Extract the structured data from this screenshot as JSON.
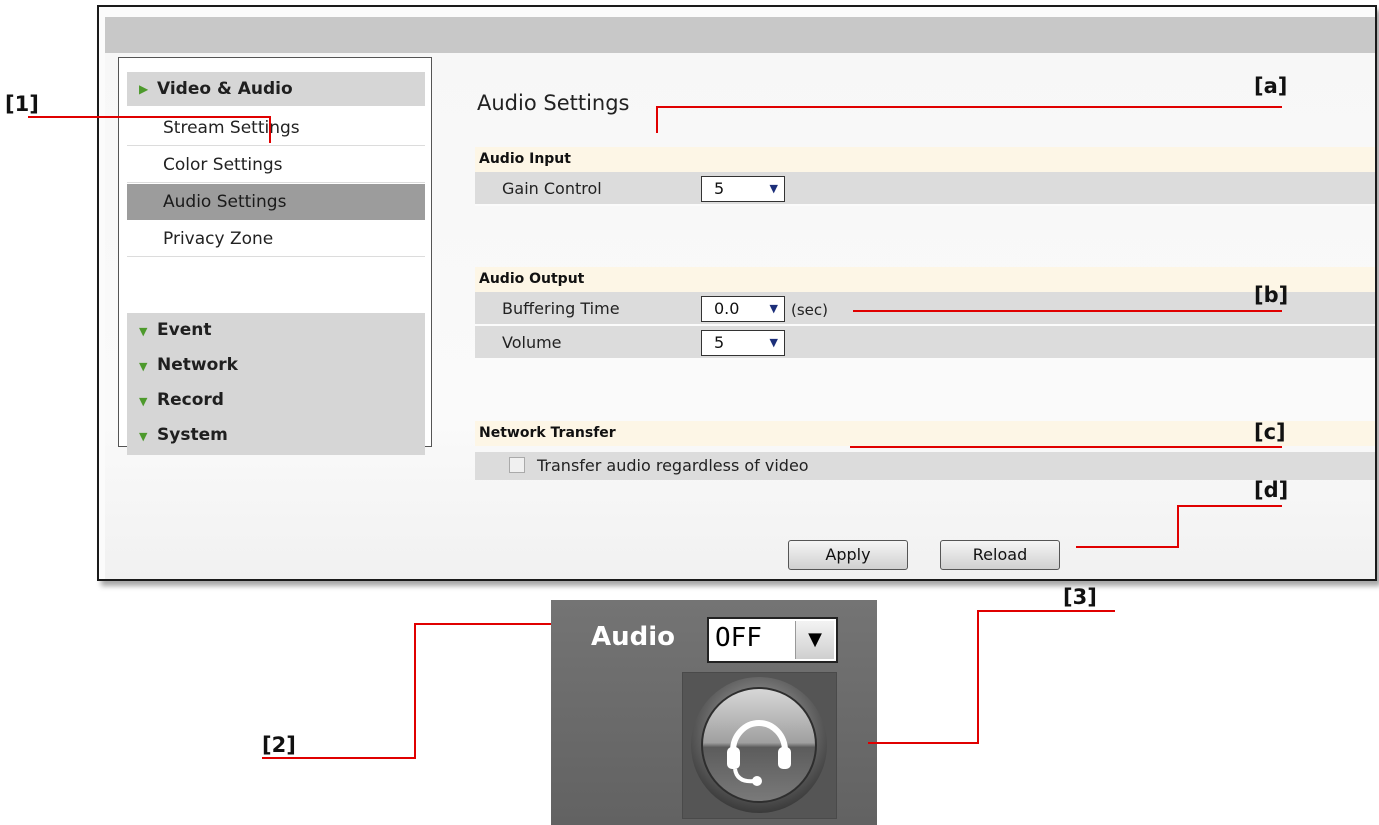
{
  "sidebar": {
    "active_group": "Video & Audio",
    "items": [
      {
        "label": "Stream Settings"
      },
      {
        "label": "Color Settings"
      },
      {
        "label": "Audio Settings"
      },
      {
        "label": "Privacy Zone"
      }
    ],
    "collapsed_groups": [
      {
        "label": "Event"
      },
      {
        "label": "Network"
      },
      {
        "label": "Record"
      },
      {
        "label": "System"
      }
    ]
  },
  "main": {
    "title": "Audio Settings",
    "audio_input": {
      "heading": "Audio Input",
      "gain_label": "Gain Control",
      "gain_value": "5"
    },
    "audio_output": {
      "heading": "Audio Output",
      "buffering_label": "Buffering Time",
      "buffering_value": "0.0",
      "buffering_unit": "(sec)",
      "volume_label": "Volume",
      "volume_value": "5"
    },
    "network_transfer": {
      "heading": "Network Transfer",
      "checkbox_label": "Transfer audio regardless of video",
      "checked": false
    },
    "apply_label": "Apply",
    "reload_label": "Reload"
  },
  "widget": {
    "label": "Audio",
    "select_value": "OFF",
    "icon": "headset-icon"
  },
  "annotations": {
    "n1": "[1]",
    "n2": "[2]",
    "n3": "[3]",
    "a": "[a]",
    "b": "[b]",
    "c": "[c]",
    "d": "[d]"
  },
  "colors": {
    "callout_line": "#e00000",
    "menu_arrow": "#4d9a2c",
    "active_item": "#9c9c9c",
    "section_header": "#fdf6e6"
  }
}
